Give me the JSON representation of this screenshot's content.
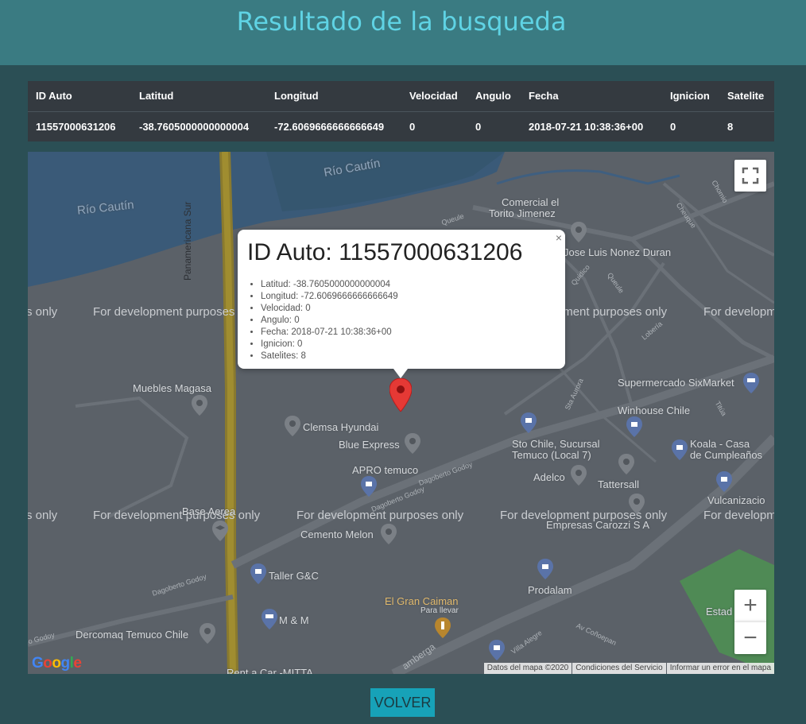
{
  "header": {
    "title": "Resultado de la busqueda"
  },
  "table": {
    "columns": [
      "ID Auto",
      "Latitud",
      "Longitud",
      "Velocidad",
      "Angulo",
      "Fecha",
      "Ignicion",
      "Satelite"
    ],
    "rows": [
      [
        "11557000631206",
        "-38.7605000000000004",
        "-72.6069666666666649",
        "0",
        "0",
        "2018-07-21 10:38:36+00",
        "0",
        "8"
      ]
    ]
  },
  "map": {
    "watermark": "For development purposes only",
    "watermark_short": "s only",
    "watermark_cut": "For developm",
    "places": {
      "rio_cautin_1": "Río Cautín",
      "rio_cautin_2": "Río Cautín",
      "comercial_1": "Comercial el",
      "comercial_2": "Torito Jimenez",
      "jose_luis": "Jose Luis Nonez Duran",
      "panamericana": "Panamericana Sur",
      "muebles": "Muebles Magasa",
      "clemsa": "Clemsa Hyundai",
      "blue_express": "Blue Express",
      "supermercado": "Supermercado SixMarket",
      "winhouse": "Winhouse Chile",
      "sto_chile_1": "Sto Chile, Sucursal",
      "sto_chile_2": "Temuco (Local 7)",
      "koala_1": "Koala - Casa",
      "koala_2": "de Cumpleaños",
      "apro": "APRO temuco",
      "adelco": "Adelco",
      "tattersall": "Tattersall",
      "base_aerea": "Base Aerea",
      "vulcanizacion": "Vulcanizacio",
      "empresas_carozzi": "Empresas Carozzi S A",
      "cemento_melon": "Cemento Melon",
      "taller": "Taller G&C",
      "prodalam": "Prodalam",
      "el_gran_caiman": "El Gran Caiman",
      "para_llevar": "Para llevar",
      "m_m": "M & M",
      "estadio": "Estad",
      "dercomaq": "Dercomaq Temuco Chile",
      "rent_a_car": "Rent a Car -MITTA"
    },
    "roads": {
      "queule": "Queule",
      "quidico": "Quidico",
      "lobería": "Lobería",
      "cheuque": "Cheuque",
      "chomio": "Chomio",
      "sta_aurora": "Sta Aurora",
      "titua": "Titúa",
      "dagoberto_godoy": "Dagoberto Godoy",
      "av_coñoepan": "Av Coñoepan",
      "villa_alegre": "Villa Alegre",
      "amberga": "amberga",
      "goday": "o Godoy"
    },
    "attribution": [
      "Datos del mapa ©2020",
      "Condiciones del Servicio",
      "Informar un error en el mapa"
    ],
    "zoom_in": "+",
    "zoom_out": "−",
    "google": [
      "G",
      "o",
      "o",
      "g",
      "l",
      "e"
    ]
  },
  "infowindow": {
    "title": "ID Auto: 11557000631206",
    "close": "×",
    "items": [
      "Latitud: -38.7605000000000004",
      "Longitud: -72.6069666666666649",
      "Velocidad: 0",
      "Angulo: 0",
      "Fecha: 2018-07-21 10:38:36+00",
      "Ignicion: 0",
      "Satelites: 8"
    ]
  },
  "footer": {
    "volver_label": "VOLVER"
  },
  "colors": {
    "background": "#2b4f55",
    "header": "#3a7b82",
    "title": "#5fd3e4",
    "table": "#343a40",
    "button": "#17a2b8",
    "marker": "#e53935"
  }
}
